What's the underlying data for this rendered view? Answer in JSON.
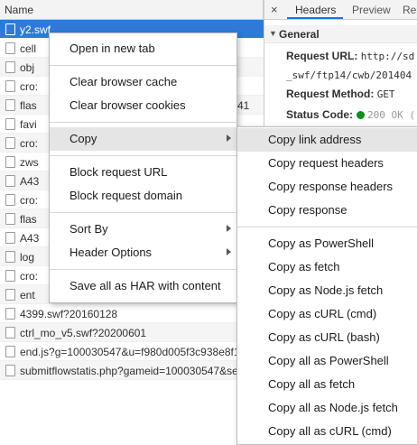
{
  "network": {
    "column_name": "Name",
    "rows": [
      {
        "name": "y2.swf",
        "selected": true
      },
      {
        "name": "cell"
      },
      {
        "name": "obj"
      },
      {
        "name": "cro:"
      },
      {
        "name": "flas",
        "suffix": "41"
      },
      {
        "name": "favi"
      },
      {
        "name": "cro:"
      },
      {
        "name": "zws"
      },
      {
        "name": "A43"
      },
      {
        "name": "cro:"
      },
      {
        "name": "flas"
      },
      {
        "name": "A43"
      },
      {
        "name": "log"
      },
      {
        "name": "cro:"
      },
      {
        "name": "ent"
      },
      {
        "name": "4399.swf?20160128"
      },
      {
        "name": "ctrl_mo_v5.swf?20200601"
      },
      {
        "name": "end.js?g=100030547&u=f980d005f3c938e8f1"
      },
      {
        "name": "submitflowstatis.php?gameid=100030547&se"
      }
    ]
  },
  "details": {
    "close_label": "×",
    "tabs": [
      {
        "label": "Headers",
        "active": true
      },
      {
        "label": "Preview"
      },
      {
        "label": "Re"
      }
    ],
    "section_general": "General",
    "request_url_key": "Request URL:",
    "request_url_val": "http://sd",
    "request_url_cont": "_swf/ftp14/cwb/201404",
    "request_method_key": "Request Method:",
    "request_method_val": "GET",
    "status_code_key": "Status Code:",
    "status_code_val": "200 OK (",
    "status_color": "#0a8f20"
  },
  "context_menu": {
    "items": [
      {
        "label": "Open in new tab"
      },
      {
        "label": "Clear browser cache"
      },
      {
        "label": "Clear browser cookies"
      },
      {
        "label": "Copy",
        "has_submenu": true,
        "highlighted": true
      },
      {
        "label": "Block request URL"
      },
      {
        "label": "Block request domain"
      },
      {
        "label": "Sort By",
        "has_submenu": true
      },
      {
        "label": "Header Options",
        "has_submenu": true
      },
      {
        "label": "Save all as HAR with content"
      }
    ]
  },
  "copy_submenu": {
    "items": [
      {
        "label": "Copy link address",
        "highlighted": true
      },
      {
        "label": "Copy request headers"
      },
      {
        "label": "Copy response headers"
      },
      {
        "label": "Copy response"
      },
      {
        "label": "Copy as PowerShell"
      },
      {
        "label": "Copy as fetch"
      },
      {
        "label": "Copy as Node.js fetch"
      },
      {
        "label": "Copy as cURL (cmd)"
      },
      {
        "label": "Copy as cURL (bash)"
      },
      {
        "label": "Copy all as PowerShell"
      },
      {
        "label": "Copy all as fetch"
      },
      {
        "label": "Copy all as Node.js fetch"
      },
      {
        "label": "Copy all as cURL (cmd)"
      }
    ]
  }
}
